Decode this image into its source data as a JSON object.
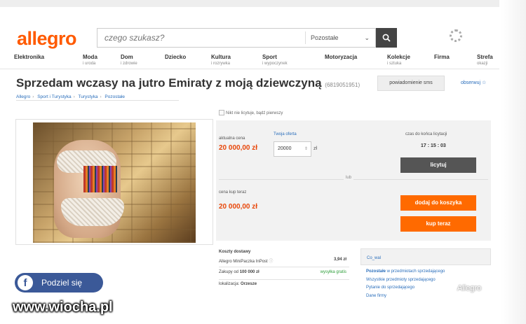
{
  "header": {
    "logo": "allegro",
    "search_placeholder": "czego szukasz?",
    "category_select": "Pozostałe"
  },
  "nav": [
    {
      "label": "Elektronika",
      "sub": ""
    },
    {
      "label": "Moda",
      "sub": "i uroda"
    },
    {
      "label": "Dom",
      "sub": "i zdrowie"
    },
    {
      "label": "Dziecko",
      "sub": ""
    },
    {
      "label": "Kultura",
      "sub": "i rozrywka"
    },
    {
      "label": "Sport",
      "sub": "i wypoczynek"
    },
    {
      "label": "Motoryzacja",
      "sub": ""
    },
    {
      "label": "Kolekcje",
      "sub": "i sztuka"
    },
    {
      "label": "Firma",
      "sub": ""
    },
    {
      "label": "Strefa",
      "sub": "okazji"
    }
  ],
  "listing": {
    "title": "Sprzedam wczasy na jutro Emiraty z moją dziewczyną",
    "number": "(6819051951)",
    "sms_button": "powiadomienie sms",
    "observe": "obserwuj ☆",
    "breadcrumbs": [
      "Allegro",
      "Sport i Turystyka",
      "Turystyka",
      "Pozostałe"
    ]
  },
  "buy": {
    "no_bids": "Nikt nie licytuje, bądź pierwszy",
    "current_price_label": "aktualna cena",
    "current_price": "20 000,00 zł",
    "your_offer_label": "Twoja oferta",
    "offer_value": "20000",
    "offer_unit": "zł",
    "time_label": "czas do końca licytacji",
    "countdown": "17 : 15 : 03",
    "bid_button": "licytuj",
    "or": "lub",
    "buynow_label": "cena kup teraz",
    "buynow_price": "20 000,00 zł",
    "cart_button": "dodaj do koszyka",
    "buy_button": "kup teraz"
  },
  "shipping": {
    "header": "Koszty dostawy",
    "method": "Allegro MiniPaczka InPost",
    "method_price": "3,94 zł",
    "purchase_prefix": "Zakupy od",
    "purchase_amount": "100 000 zł",
    "free": "wysyłka gratis",
    "location_label": "lokalizacja:",
    "location": "Orzesze"
  },
  "seller": {
    "name": "Co_wal",
    "links": [
      {
        "bold": "Pozostałe",
        "rest": " w przedmiotach sprzedającego"
      },
      {
        "bold": "",
        "rest": "Wszystkie przedmioty sprzedającego"
      },
      {
        "bold": "",
        "rest": "Pytanie do sprzedającego"
      },
      {
        "bold": "",
        "rest": "Dane firmy"
      }
    ]
  },
  "overlay": {
    "share": "Podziel się",
    "watermark": "www.wiocha.pl",
    "allegro_wm": "Allegro"
  },
  "colors": {
    "accent": "#ff5a00",
    "link": "#2a6ebb",
    "price": "#e8470a",
    "facebook": "#3b5998"
  }
}
